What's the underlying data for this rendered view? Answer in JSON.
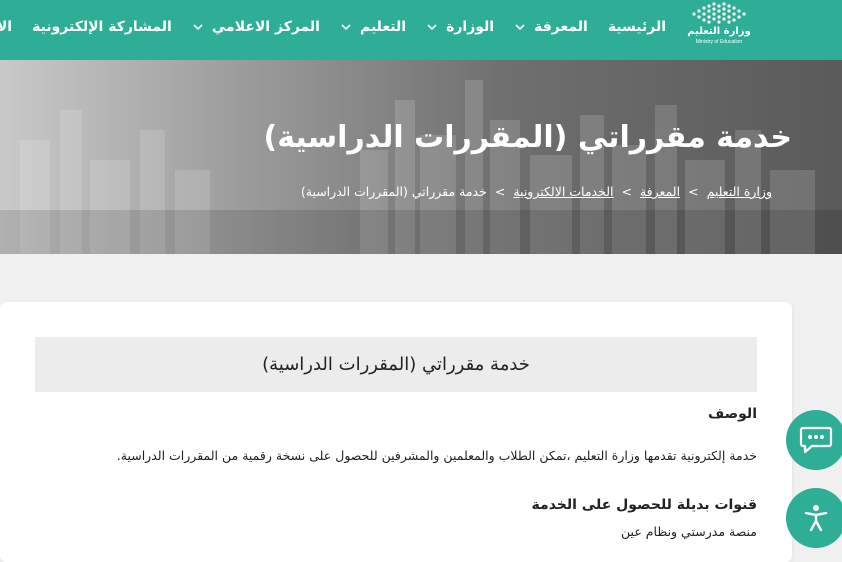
{
  "logo": {
    "name_ar": "وزارة التعليم",
    "name_en": "Ministry of Education"
  },
  "nav": {
    "items": [
      {
        "label": "الرئيسية",
        "has_dropdown": false
      },
      {
        "label": "المعرفة",
        "has_dropdown": true
      },
      {
        "label": "الوزارة",
        "has_dropdown": true
      },
      {
        "label": "التعليم",
        "has_dropdown": true
      },
      {
        "label": "المركز الاعلامي",
        "has_dropdown": true
      },
      {
        "label": "المشاركة الإلكترونية",
        "has_dropdown": false
      },
      {
        "label": "الاستثما",
        "has_dropdown": false
      }
    ]
  },
  "hero": {
    "title": "خدمة مقرراتي (المقررات الدراسية)",
    "breadcrumb": [
      "وزارة التعليم",
      "المعرفة",
      "الخدمات الالكترونية",
      "خدمة مقرراتي (المقررات الدراسية)"
    ],
    "separator": ">"
  },
  "content": {
    "card_title": "خدمة مقرراتي (المقررات الدراسية)",
    "description_label": "الوصف",
    "description_text": "خدمة إلكترونية تقدمها وزارة التعليم ،تمكن الطلاب والمعلمين والمشرفين للحصول على نسخة رقمية من المقررات الدراسية.",
    "alt_channels_label": "قنوات بديلة للحصول على الخدمة",
    "alt_channels_text": "منصة مدرستي ونظام عين"
  },
  "floating": {
    "chat_icon": "chat-bubble-icon",
    "accessibility_icon": "accessibility-icon"
  },
  "colors": {
    "brand": "#2fae97",
    "card_head_bg": "#ececec"
  }
}
